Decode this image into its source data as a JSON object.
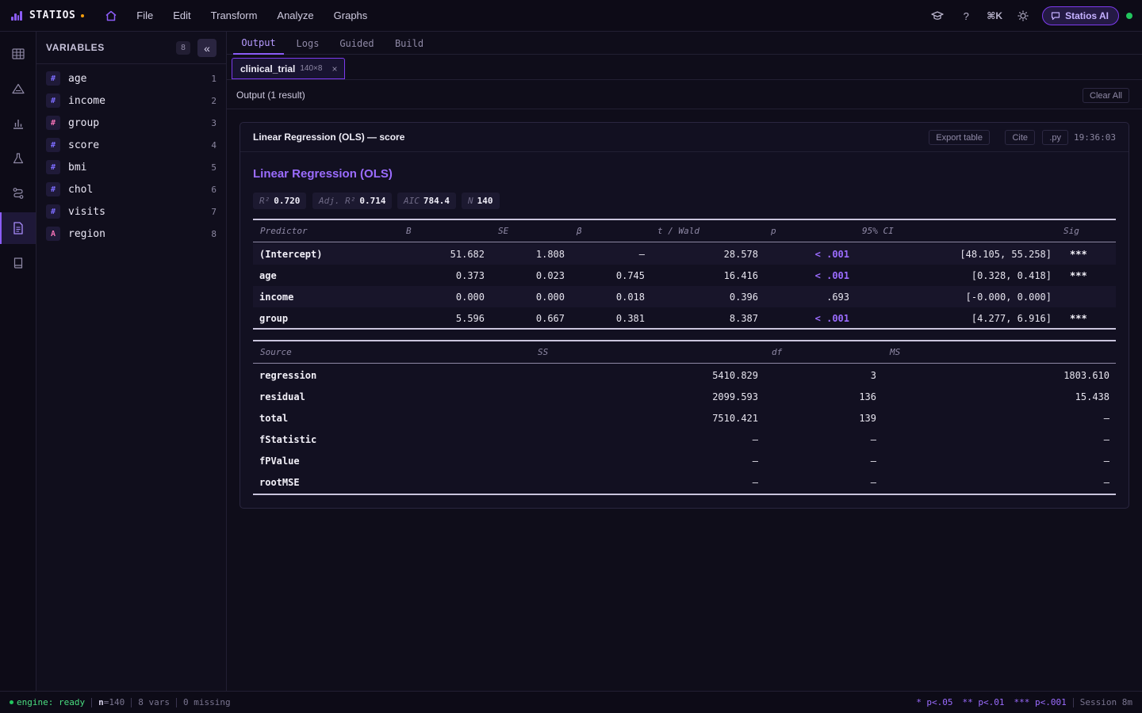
{
  "app": {
    "name": "STATIOS",
    "menu": [
      "File",
      "Edit",
      "Transform",
      "Analyze",
      "Graphs"
    ],
    "shortcut": "⌘K",
    "help": "?",
    "ai_button": "Statios AI",
    "accent": "#8b5cf6",
    "status_color": "#22c55e"
  },
  "rail": [
    "table-icon",
    "triangle-icon",
    "bar-chart-icon",
    "flask-icon",
    "flow-icon",
    "document-icon",
    "book-icon"
  ],
  "variables": {
    "title": "VARIABLES",
    "count": "8",
    "collapse": "«",
    "items": [
      {
        "type": "#",
        "name": "age",
        "index": "1",
        "color": "#7c6cff"
      },
      {
        "type": "#",
        "name": "income",
        "index": "2",
        "color": "#7c6cff"
      },
      {
        "type": "#",
        "name": "group",
        "index": "3",
        "color": "#f472b6"
      },
      {
        "type": "#",
        "name": "score",
        "index": "4",
        "color": "#7c6cff"
      },
      {
        "type": "#",
        "name": "bmi",
        "index": "5",
        "color": "#7c6cff"
      },
      {
        "type": "#",
        "name": "chol",
        "index": "6",
        "color": "#7c6cff"
      },
      {
        "type": "#",
        "name": "visits",
        "index": "7",
        "color": "#7c6cff"
      },
      {
        "type": "A",
        "name": "region",
        "index": "8",
        "color": "#f472b6"
      }
    ]
  },
  "tabs": [
    "Output",
    "Logs",
    "Guided",
    "Build"
  ],
  "dataset_tab": {
    "name": "clinical_trial",
    "dims": "140×8",
    "close": "×"
  },
  "output": {
    "title": "Output (1 result)",
    "clear": "Clear All"
  },
  "result": {
    "title": "Linear Regression (OLS) — score",
    "buttons": {
      "export": "Export table",
      "cite": "Cite",
      "py": ".py"
    },
    "time": "19:36:03",
    "method": "Linear Regression (OLS)",
    "stats": [
      {
        "label": "R²",
        "value": "0.720"
      },
      {
        "label": "Adj. R²",
        "value": "0.714"
      },
      {
        "label": "AIC",
        "value": "784.4"
      },
      {
        "label": "N",
        "value": "140"
      }
    ],
    "coef_headers": [
      "Predictor",
      "B",
      "SE",
      "β",
      "t / Wald",
      "p",
      "95% CI",
      "Sig"
    ],
    "coefficients": [
      {
        "predictor": "(Intercept)",
        "b": "51.682",
        "se": "1.808",
        "beta": "—",
        "t": "28.578",
        "p": "< .001",
        "ci": "[48.105, 55.258]",
        "sig": "***"
      },
      {
        "predictor": "age",
        "b": "0.373",
        "se": "0.023",
        "beta": "0.745",
        "t": "16.416",
        "p": "< .001",
        "ci": "[0.328, 0.418]",
        "sig": "***"
      },
      {
        "predictor": "income",
        "b": "0.000",
        "se": "0.000",
        "beta": "0.018",
        "t": "0.396",
        "p": ".693",
        "ci": "[-0.000, 0.000]",
        "sig": ""
      },
      {
        "predictor": "group",
        "b": "5.596",
        "se": "0.667",
        "beta": "0.381",
        "t": "8.387",
        "p": "< .001",
        "ci": "[4.277, 6.916]",
        "sig": "***"
      }
    ],
    "anova_headers": [
      "Source",
      "SS",
      "df",
      "MS"
    ],
    "anova": [
      {
        "source": "regression",
        "ss": "5410.829",
        "df": "3",
        "ms": "1803.610"
      },
      {
        "source": "residual",
        "ss": "2099.593",
        "df": "136",
        "ms": "15.438"
      },
      {
        "source": "total",
        "ss": "7510.421",
        "df": "139",
        "ms": "—"
      },
      {
        "source": "fStatistic",
        "ss": "—",
        "df": "—",
        "ms": "—"
      },
      {
        "source": "fPValue",
        "ss": "—",
        "df": "—",
        "ms": "—"
      },
      {
        "source": "rootMSE",
        "ss": "—",
        "df": "—",
        "ms": "—"
      }
    ]
  },
  "statusbar": {
    "engine": "engine: ready",
    "n_label": "n",
    "n_value": "=140",
    "vars": "8 vars",
    "missing": "0 missing",
    "legend": [
      "* p<.05",
      "** p<.01",
      "*** p<.001"
    ],
    "session": "Session 8m"
  }
}
